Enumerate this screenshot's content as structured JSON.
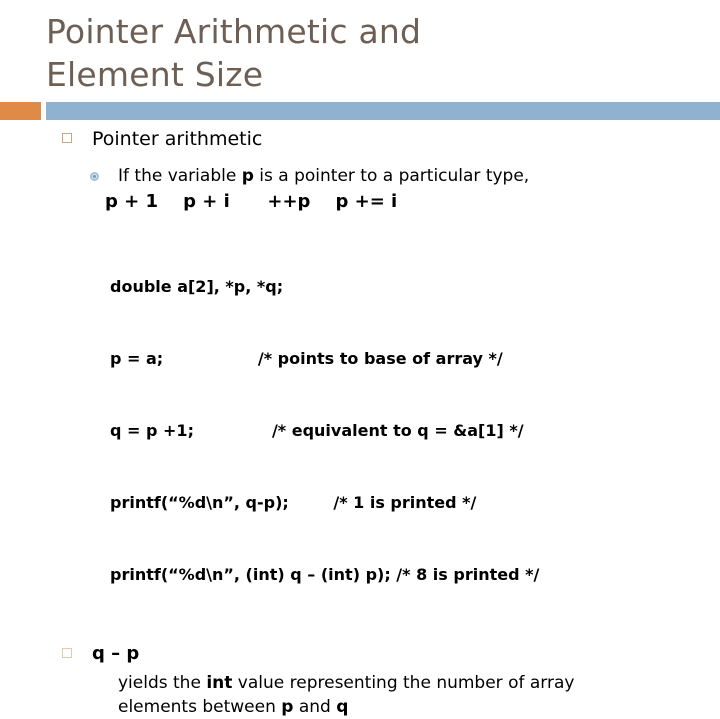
{
  "slide": {
    "title_lines": [
      "Pointer Arithmetic and",
      "Element Size"
    ],
    "colors": {
      "title_text": "#6e5f55",
      "rule_orange": "#e08a48",
      "rule_blue": "#8fb2d1",
      "bullet_square_border": "#c8a882",
      "bullet_ring": "#a9c0d4",
      "body_text": "#000000",
      "background": "#ffffff"
    },
    "bullets": {
      "level1_first": "Pointer arithmetic",
      "level2_first_pre": "If the variable ",
      "level2_first_bold": "p",
      "level2_first_post": " is a pointer to a particular type,",
      "expressions_line": "p + 1    p + i      ++p    p += i",
      "level1_second": "q – p",
      "level2_second_pre": "yields the ",
      "level2_second_bold": "int",
      "level2_second_mid": " value representing the number of array elements between ",
      "level2_second_bold2": "p",
      "level2_second_mid2": " and ",
      "level2_second_bold3": "q"
    },
    "code": {
      "lines": [
        "double a[2], *p, *q;",
        "p = a;                 /* points to base of array */",
        "q = p +1;              /* equivalent to q = &a[1] */",
        "printf(“%d\\n”, q-p);        /* 1 is printed */",
        "printf(“%d\\n”, (int) q – (int) p); /* 8 is printed */"
      ]
    },
    "icons": {
      "bullet_square": "square-outline-bullet-icon",
      "bullet_ring": "ring-bullet-icon"
    }
  }
}
